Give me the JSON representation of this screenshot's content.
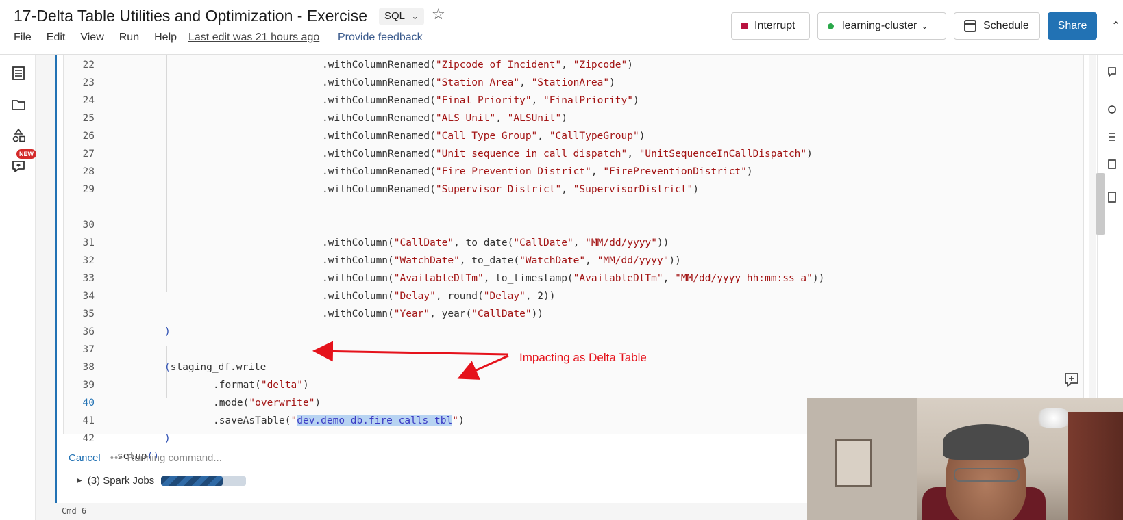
{
  "header": {
    "title": "17-Delta Table Utilities and Optimization - Exercise",
    "language": "SQL",
    "menu": [
      "File",
      "Edit",
      "View",
      "Run",
      "Help"
    ],
    "last_edit": "Last edit was 21 hours ago",
    "feedback": "Provide feedback",
    "interrupt_label": "Interrupt",
    "cluster_label": "learning-cluster",
    "schedule_label": "Schedule",
    "share_label": "Share"
  },
  "left_rail": {
    "new_badge": "NEW"
  },
  "code": {
    "lines": [
      {
        "n": "22",
        "pre": ".withColumnRenamed(",
        "a": "\"Zipcode of Incident\"",
        "b": "\"Zipcode\"",
        "post": ")"
      },
      {
        "n": "23",
        "pre": ".withColumnRenamed(",
        "a": "\"Station Area\"",
        "b": "\"StationArea\"",
        "post": ")"
      },
      {
        "n": "24",
        "pre": ".withColumnRenamed(",
        "a": "\"Final Priority\"",
        "b": "\"FinalPriority\"",
        "post": ")"
      },
      {
        "n": "25",
        "pre": ".withColumnRenamed(",
        "a": "\"ALS Unit\"",
        "b": "\"ALSUnit\"",
        "post": ")"
      },
      {
        "n": "26",
        "pre": ".withColumnRenamed(",
        "a": "\"Call Type Group\"",
        "b": "\"CallTypeGroup\"",
        "post": ")"
      },
      {
        "n": "27",
        "pre": ".withColumnRenamed(",
        "a": "\"Unit sequence in call dispatch\"",
        "b": "\"UnitSequenceInCallDispatch\"",
        "post": ")"
      },
      {
        "n": "28",
        "pre": ".withColumnRenamed(",
        "a": "\"Fire Prevention District\"",
        "b": "\"FirePreventionDistrict\"",
        "post": ")"
      },
      {
        "n": "29",
        "pre": ".withColumnRenamed(",
        "a": "\"Supervisor District\"",
        "b": "\"SupervisorDistrict\"",
        "post": ")"
      }
    ],
    "l30": {
      "n": "30",
      "t1": ".withColumn(",
      "s1": "\"CallDate\"",
      "t2": ", to_date(",
      "s2": "\"CallDate\"",
      "t3": ", ",
      "s3": "\"MM/dd/yyyy\"",
      "t4": "))"
    },
    "l31": {
      "n": "31",
      "t1": ".withColumn(",
      "s1": "\"WatchDate\"",
      "t2": ", to_date(",
      "s2": "\"WatchDate\"",
      "t3": ", ",
      "s3": "\"MM/dd/yyyy\"",
      "t4": "))"
    },
    "l32": {
      "n": "32",
      "t1": ".withColumn(",
      "s1": "\"AvailableDtTm\"",
      "t2": ", to_timestamp(",
      "s2": "\"AvailableDtTm\"",
      "t3": ", ",
      "s3": "\"MM/dd/yyyy hh:mm:ss a\"",
      "t4": "))"
    },
    "l33": {
      "n": "33",
      "t1": ".withColumn(",
      "s1": "\"Delay\"",
      "t2": ", round(",
      "s2": "\"Delay\"",
      "t3": ", 2))"
    },
    "l34": {
      "n": "34",
      "t1": ".withColumn(",
      "s1": "\"Year\"",
      "t2": ", year(",
      "s2": "\"CallDate\"",
      "t3": "))"
    },
    "l35": {
      "n": "35",
      "t": ")"
    },
    "l36": {
      "n": "36"
    },
    "l37": {
      "n": "37",
      "p": "(",
      "t": "staging_df.write"
    },
    "l38": {
      "n": "38",
      "t1": ".format(",
      "s1": "\"delta\"",
      "t2": ")"
    },
    "l39": {
      "n": "39",
      "t1": ".mode(",
      "s1": "\"overwrite\"",
      "t2": ")"
    },
    "l40": {
      "n": "40",
      "t1": ".saveAsTable(",
      "q": "\"",
      "sel": "dev.demo_db.fire_calls_tbl",
      "q2": "\"",
      "t2": ")"
    },
    "l41": {
      "n": "41",
      "t": ")"
    },
    "l42": {
      "n": "42",
      "t": "setup",
      "p": "()"
    }
  },
  "annotation": "Impacting as Delta Table",
  "status": {
    "cancel": "Cancel",
    "running": "Running command...",
    "spark_jobs": "(3) Spark Jobs",
    "progress": 0.72,
    "cmd": "Cmd 6"
  },
  "colors": {
    "accent": "#2272b4",
    "string": "#a31515",
    "annotation": "#e5121b"
  }
}
